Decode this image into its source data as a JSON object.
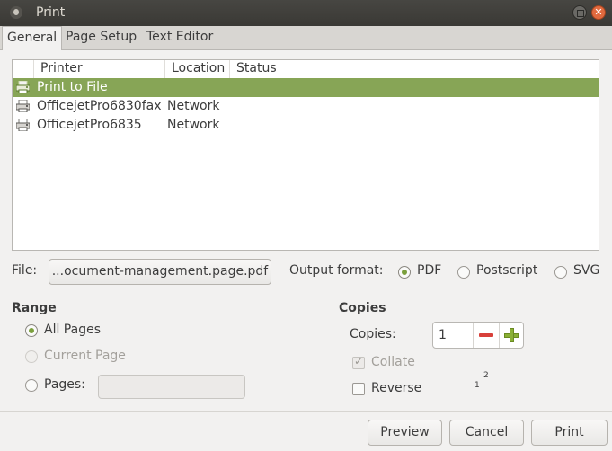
{
  "window": {
    "title": "Print"
  },
  "tabs": [
    {
      "label": "General",
      "active": true
    },
    {
      "label": "Page Setup",
      "active": false
    },
    {
      "label": "Text Editor",
      "active": false
    }
  ],
  "printer_list": {
    "columns": [
      "Printer",
      "Location",
      "Status"
    ],
    "rows": [
      {
        "printer": "Print to File",
        "location": "",
        "status": "",
        "selected": true,
        "icon": "file-printer-icon"
      },
      {
        "printer": "OfficejetPro6830fax",
        "location": "Network",
        "status": "",
        "selected": false,
        "icon": "printer-icon"
      },
      {
        "printer": "OfficejetPro6835",
        "location": "Network",
        "status": "",
        "selected": false,
        "icon": "printer-icon"
      }
    ]
  },
  "file": {
    "label": "File:",
    "value": "...ocument-management.page.pdf"
  },
  "output_format": {
    "label": "Output format:",
    "options": [
      "PDF",
      "Postscript",
      "SVG"
    ],
    "selected": "PDF"
  },
  "range": {
    "title": "Range",
    "all_pages": "All Pages",
    "current_page": "Current Page",
    "pages": "Pages:",
    "pages_value": "",
    "selected": "All Pages"
  },
  "copies": {
    "title": "Copies",
    "label": "Copies:",
    "value": "1",
    "collate": "Collate",
    "collate_checked": true,
    "reverse": "Reverse",
    "reverse_checked": false,
    "preview_first": "1",
    "preview_second": "2"
  },
  "buttons": {
    "preview": "Preview",
    "cancel": "Cancel",
    "print": "Print"
  },
  "colors": {
    "selection": "#87a556",
    "radio_accent": "#7a9f3c",
    "close_button": "#e16a3f"
  }
}
